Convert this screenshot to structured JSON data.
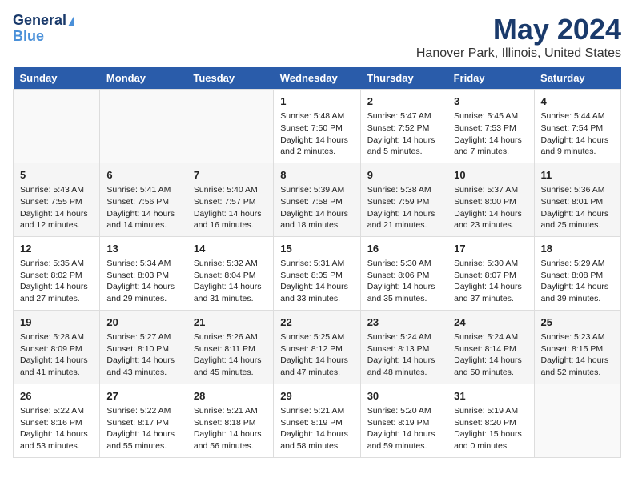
{
  "header": {
    "logo_line1": "General",
    "logo_line2": "Blue",
    "month": "May 2024",
    "location": "Hanover Park, Illinois, United States"
  },
  "days_of_week": [
    "Sunday",
    "Monday",
    "Tuesday",
    "Wednesday",
    "Thursday",
    "Friday",
    "Saturday"
  ],
  "weeks": [
    [
      {
        "day": "",
        "info": ""
      },
      {
        "day": "",
        "info": ""
      },
      {
        "day": "",
        "info": ""
      },
      {
        "day": "1",
        "info": "Sunrise: 5:48 AM\nSunset: 7:50 PM\nDaylight: 14 hours\nand 2 minutes."
      },
      {
        "day": "2",
        "info": "Sunrise: 5:47 AM\nSunset: 7:52 PM\nDaylight: 14 hours\nand 5 minutes."
      },
      {
        "day": "3",
        "info": "Sunrise: 5:45 AM\nSunset: 7:53 PM\nDaylight: 14 hours\nand 7 minutes."
      },
      {
        "day": "4",
        "info": "Sunrise: 5:44 AM\nSunset: 7:54 PM\nDaylight: 14 hours\nand 9 minutes."
      }
    ],
    [
      {
        "day": "5",
        "info": "Sunrise: 5:43 AM\nSunset: 7:55 PM\nDaylight: 14 hours\nand 12 minutes."
      },
      {
        "day": "6",
        "info": "Sunrise: 5:41 AM\nSunset: 7:56 PM\nDaylight: 14 hours\nand 14 minutes."
      },
      {
        "day": "7",
        "info": "Sunrise: 5:40 AM\nSunset: 7:57 PM\nDaylight: 14 hours\nand 16 minutes."
      },
      {
        "day": "8",
        "info": "Sunrise: 5:39 AM\nSunset: 7:58 PM\nDaylight: 14 hours\nand 18 minutes."
      },
      {
        "day": "9",
        "info": "Sunrise: 5:38 AM\nSunset: 7:59 PM\nDaylight: 14 hours\nand 21 minutes."
      },
      {
        "day": "10",
        "info": "Sunrise: 5:37 AM\nSunset: 8:00 PM\nDaylight: 14 hours\nand 23 minutes."
      },
      {
        "day": "11",
        "info": "Sunrise: 5:36 AM\nSunset: 8:01 PM\nDaylight: 14 hours\nand 25 minutes."
      }
    ],
    [
      {
        "day": "12",
        "info": "Sunrise: 5:35 AM\nSunset: 8:02 PM\nDaylight: 14 hours\nand 27 minutes."
      },
      {
        "day": "13",
        "info": "Sunrise: 5:34 AM\nSunset: 8:03 PM\nDaylight: 14 hours\nand 29 minutes."
      },
      {
        "day": "14",
        "info": "Sunrise: 5:32 AM\nSunset: 8:04 PM\nDaylight: 14 hours\nand 31 minutes."
      },
      {
        "day": "15",
        "info": "Sunrise: 5:31 AM\nSunset: 8:05 PM\nDaylight: 14 hours\nand 33 minutes."
      },
      {
        "day": "16",
        "info": "Sunrise: 5:30 AM\nSunset: 8:06 PM\nDaylight: 14 hours\nand 35 minutes."
      },
      {
        "day": "17",
        "info": "Sunrise: 5:30 AM\nSunset: 8:07 PM\nDaylight: 14 hours\nand 37 minutes."
      },
      {
        "day": "18",
        "info": "Sunrise: 5:29 AM\nSunset: 8:08 PM\nDaylight: 14 hours\nand 39 minutes."
      }
    ],
    [
      {
        "day": "19",
        "info": "Sunrise: 5:28 AM\nSunset: 8:09 PM\nDaylight: 14 hours\nand 41 minutes."
      },
      {
        "day": "20",
        "info": "Sunrise: 5:27 AM\nSunset: 8:10 PM\nDaylight: 14 hours\nand 43 minutes."
      },
      {
        "day": "21",
        "info": "Sunrise: 5:26 AM\nSunset: 8:11 PM\nDaylight: 14 hours\nand 45 minutes."
      },
      {
        "day": "22",
        "info": "Sunrise: 5:25 AM\nSunset: 8:12 PM\nDaylight: 14 hours\nand 47 minutes."
      },
      {
        "day": "23",
        "info": "Sunrise: 5:24 AM\nSunset: 8:13 PM\nDaylight: 14 hours\nand 48 minutes."
      },
      {
        "day": "24",
        "info": "Sunrise: 5:24 AM\nSunset: 8:14 PM\nDaylight: 14 hours\nand 50 minutes."
      },
      {
        "day": "25",
        "info": "Sunrise: 5:23 AM\nSunset: 8:15 PM\nDaylight: 14 hours\nand 52 minutes."
      }
    ],
    [
      {
        "day": "26",
        "info": "Sunrise: 5:22 AM\nSunset: 8:16 PM\nDaylight: 14 hours\nand 53 minutes."
      },
      {
        "day": "27",
        "info": "Sunrise: 5:22 AM\nSunset: 8:17 PM\nDaylight: 14 hours\nand 55 minutes."
      },
      {
        "day": "28",
        "info": "Sunrise: 5:21 AM\nSunset: 8:18 PM\nDaylight: 14 hours\nand 56 minutes."
      },
      {
        "day": "29",
        "info": "Sunrise: 5:21 AM\nSunset: 8:19 PM\nDaylight: 14 hours\nand 58 minutes."
      },
      {
        "day": "30",
        "info": "Sunrise: 5:20 AM\nSunset: 8:19 PM\nDaylight: 14 hours\nand 59 minutes."
      },
      {
        "day": "31",
        "info": "Sunrise: 5:19 AM\nSunset: 8:20 PM\nDaylight: 15 hours\nand 0 minutes."
      },
      {
        "day": "",
        "info": ""
      }
    ]
  ]
}
